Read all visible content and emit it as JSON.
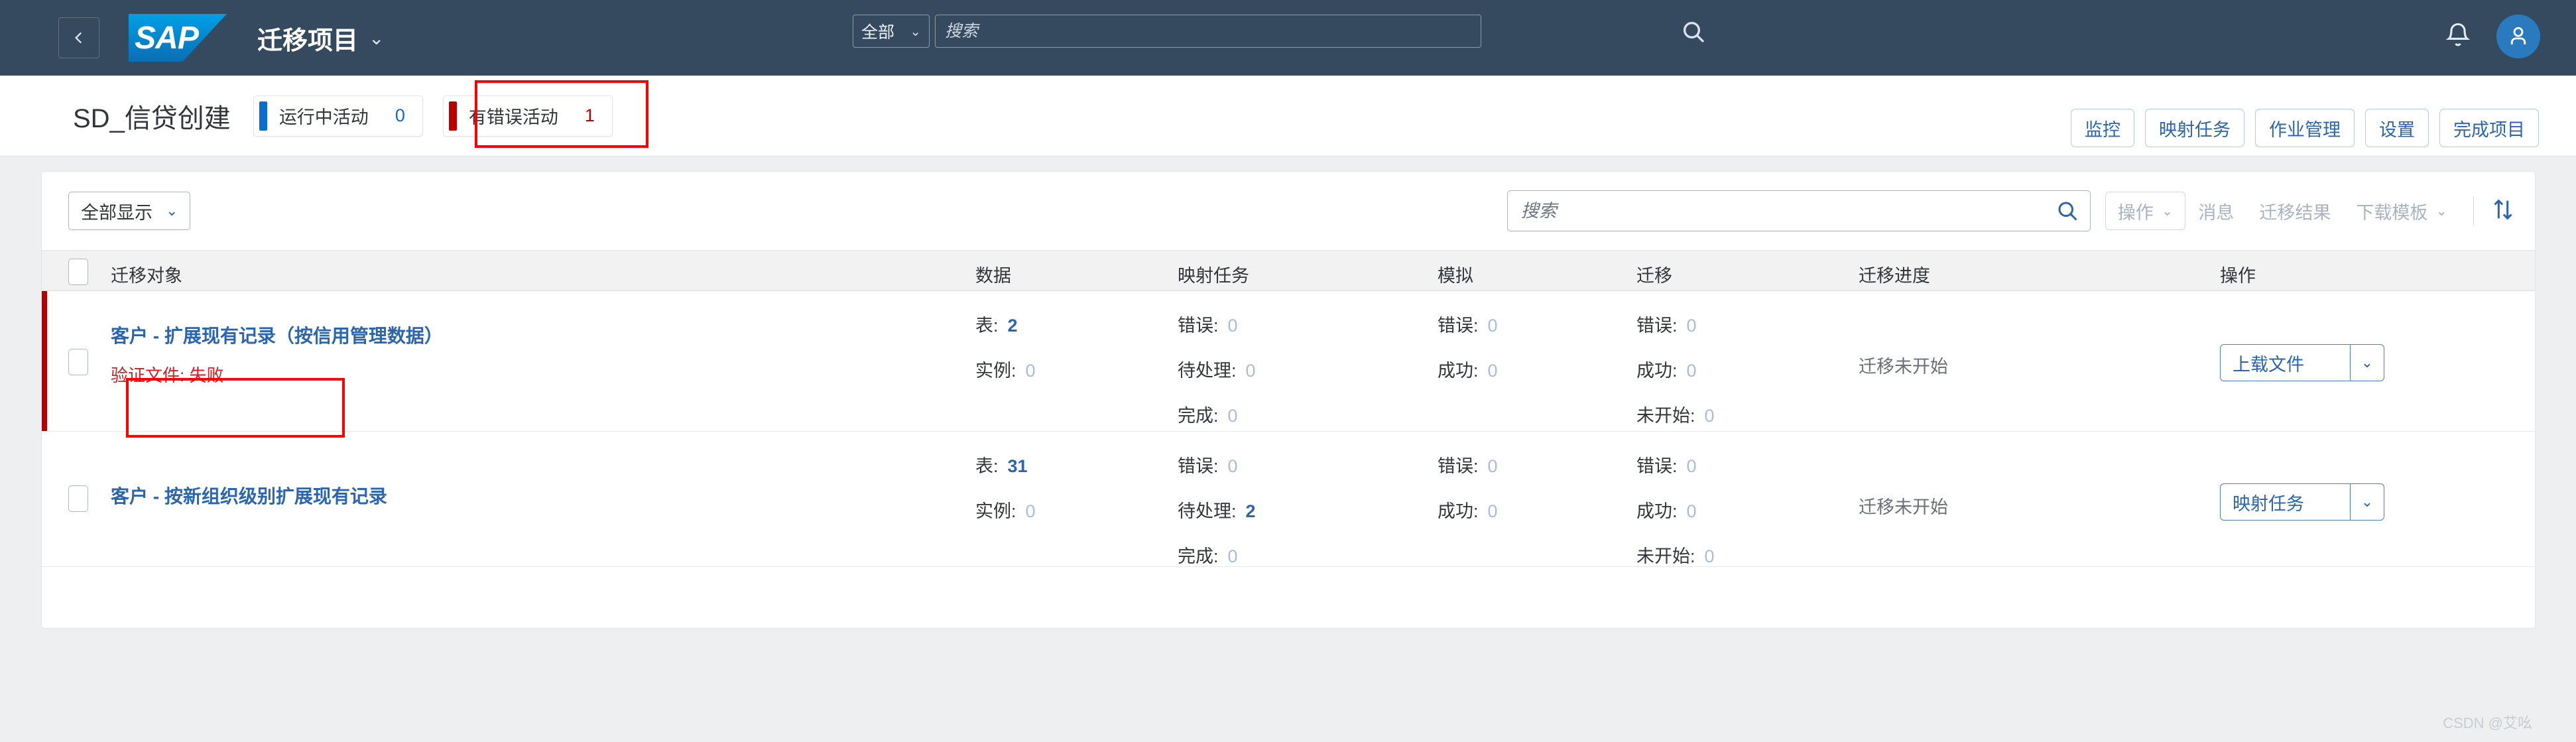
{
  "shell": {
    "back_icon": "chevron-left-icon",
    "logo_text": "SAP",
    "app_title": "迁移项目",
    "app_title_chevron": "⌄",
    "search_scope": "全部",
    "search_scope_chevron": "⌄",
    "search_placeholder": "搜索",
    "search_value": "",
    "search_icon": "search-icon",
    "bell_icon": "bell-icon",
    "avatar_icon": "user-avatar-icon",
    "bg_color": "#354a5f"
  },
  "title_bar": {
    "project_name": "SD_信贷创建",
    "kpis": [
      {
        "label": "运行中活动",
        "value": "0",
        "bar_color": "#0a6ed1",
        "value_color": "#0a6ed1"
      },
      {
        "label": "有错误活动",
        "value": "1",
        "bar_color": "#bb0000",
        "value_color": "#bb0000"
      }
    ],
    "actions": [
      {
        "label": "监控"
      },
      {
        "label": "映射任务"
      },
      {
        "label": "作业管理"
      },
      {
        "label": "设置"
      },
      {
        "label": "完成项目"
      }
    ]
  },
  "toolbar": {
    "view_filter": "全部显示",
    "view_filter_chevron": "⌄",
    "search_placeholder": "搜索",
    "search_value": "",
    "search_icon": "search-icon",
    "buttons": [
      {
        "label": "操作",
        "chevron": "⌄",
        "disabled": true,
        "framed": true
      },
      {
        "label": "消息",
        "chevron": "",
        "disabled": true,
        "framed": false
      },
      {
        "label": "迁移结果",
        "chevron": "",
        "disabled": true,
        "framed": false
      },
      {
        "label": "下载模板",
        "chevron": "⌄",
        "disabled": true,
        "framed": false
      }
    ],
    "sort_icon": "sort-updown-icon"
  },
  "table": {
    "columns": [
      {
        "key": "object",
        "label": "迁移对象"
      },
      {
        "key": "data",
        "label": "数据"
      },
      {
        "key": "mapping",
        "label": "映射任务"
      },
      {
        "key": "simulation",
        "label": "模拟"
      },
      {
        "key": "migration",
        "label": "迁移"
      },
      {
        "key": "progress",
        "label": "迁移进度"
      },
      {
        "key": "action",
        "label": "操作"
      }
    ],
    "rows": [
      {
        "selected": false,
        "status_color": "#bb0000",
        "object_name": "客户 - 扩展现有记录（按信用管理数据）",
        "error_text": "验证文件: 失败",
        "data": [
          {
            "label": "表:",
            "value": "2",
            "highlight": true
          },
          {
            "label": "实例:",
            "value": "0",
            "highlight": false
          }
        ],
        "mapping": [
          {
            "label": "错误:",
            "value": "0",
            "highlight": false
          },
          {
            "label": "待处理:",
            "value": "0",
            "highlight": false
          },
          {
            "label": "完成:",
            "value": "0",
            "highlight": false
          }
        ],
        "simulation": [
          {
            "label": "错误:",
            "value": "0",
            "highlight": false
          },
          {
            "label": "成功:",
            "value": "0",
            "highlight": false
          }
        ],
        "migration": [
          {
            "label": "错误:",
            "value": "0",
            "highlight": false
          },
          {
            "label": "成功:",
            "value": "0",
            "highlight": false
          },
          {
            "label": "未开始:",
            "value": "0",
            "highlight": false
          }
        ],
        "progress": "迁移未开始",
        "action_label": "上载文件",
        "action_chevron": "⌄"
      },
      {
        "selected": false,
        "status_color": "transparent",
        "object_name": "客户 - 按新组织级别扩展现有记录",
        "error_text": "",
        "data": [
          {
            "label": "表:",
            "value": "31",
            "highlight": true
          },
          {
            "label": "实例:",
            "value": "0",
            "highlight": false
          }
        ],
        "mapping": [
          {
            "label": "错误:",
            "value": "0",
            "highlight": false
          },
          {
            "label": "待处理:",
            "value": "2",
            "highlight": true
          },
          {
            "label": "完成:",
            "value": "0",
            "highlight": false
          }
        ],
        "simulation": [
          {
            "label": "错误:",
            "value": "0",
            "highlight": false
          },
          {
            "label": "成功:",
            "value": "0",
            "highlight": false
          }
        ],
        "migration": [
          {
            "label": "错误:",
            "value": "0",
            "highlight": false
          },
          {
            "label": "成功:",
            "value": "0",
            "highlight": false
          },
          {
            "label": "未开始:",
            "value": "0",
            "highlight": false
          }
        ],
        "progress": "迁移未开始",
        "action_label": "映射任务",
        "action_chevron": "⌄"
      }
    ]
  },
  "annotations": {
    "color": "#ff0000"
  },
  "watermark": "CSDN @艾吆"
}
